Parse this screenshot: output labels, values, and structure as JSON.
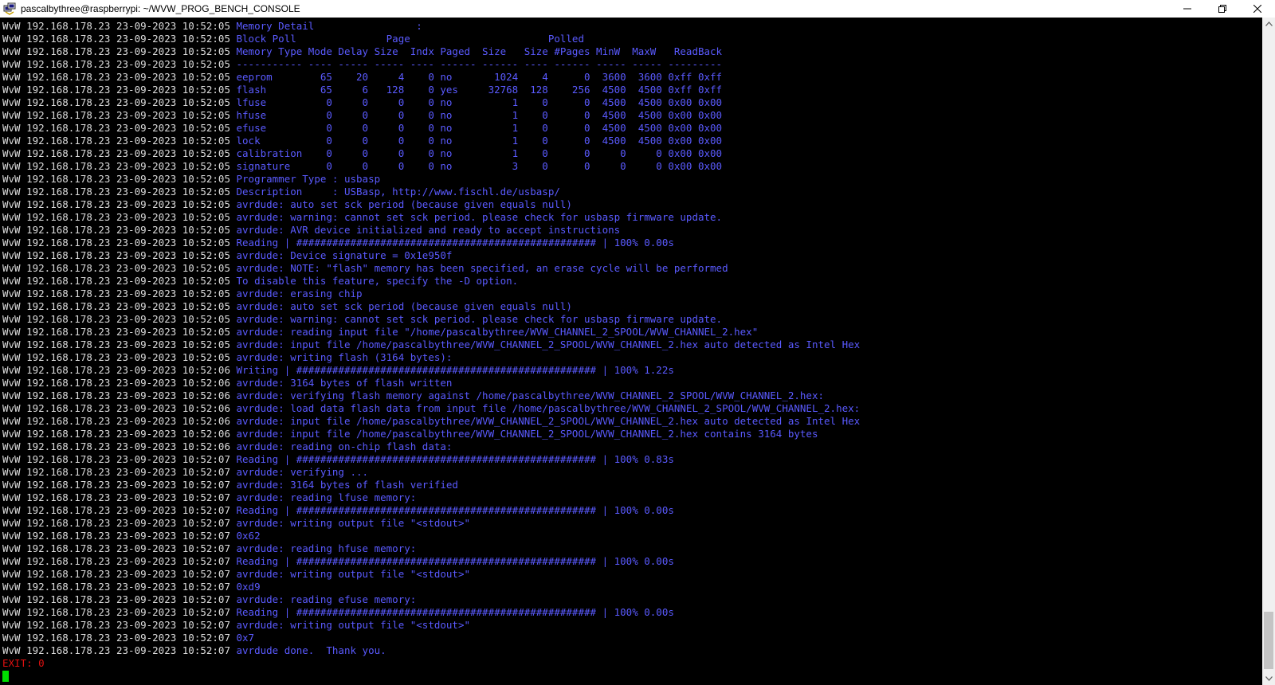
{
  "window": {
    "title": "pascalbythree@raspberrypi: ~/WVW_PROG_BENCH_CONSOLE",
    "controls": [
      "minimize",
      "restore",
      "close"
    ]
  },
  "colors": {
    "background": "#000000",
    "prefix": "#dcdcdc",
    "message": "#5a5aff",
    "exit": "#e01010",
    "cursor": "#00dd00"
  },
  "terminal": {
    "prefix_part": "WvW 192.168.178.23 23-09-2023 ",
    "lines": [
      {
        "time": "10:52:05",
        "msg": "Memory Detail                 :"
      },
      {
        "time": "10:52:05",
        "msg": "Block Poll               Page                       Polled"
      },
      {
        "time": "10:52:05",
        "msg": "Memory Type Mode Delay Size  Indx Paged  Size   Size #Pages MinW  MaxW   ReadBack"
      },
      {
        "time": "10:52:05",
        "msg": "----------- ---- ----- ----- ---- ------ ------ ---- ------ ----- ----- ---------"
      },
      {
        "time": "10:52:05",
        "msg": "eeprom        65    20     4    0 no       1024    4      0  3600  3600 0xff 0xff"
      },
      {
        "time": "10:52:05",
        "msg": "flash         65     6   128    0 yes     32768  128    256  4500  4500 0xff 0xff"
      },
      {
        "time": "10:52:05",
        "msg": "lfuse          0     0     0    0 no          1    0      0  4500  4500 0x00 0x00"
      },
      {
        "time": "10:52:05",
        "msg": "hfuse          0     0     0    0 no          1    0      0  4500  4500 0x00 0x00"
      },
      {
        "time": "10:52:05",
        "msg": "efuse          0     0     0    0 no          1    0      0  4500  4500 0x00 0x00"
      },
      {
        "time": "10:52:05",
        "msg": "lock           0     0     0    0 no          1    0      0  4500  4500 0x00 0x00"
      },
      {
        "time": "10:52:05",
        "msg": "calibration    0     0     0    0 no          1    0      0     0     0 0x00 0x00"
      },
      {
        "time": "10:52:05",
        "msg": "signature      0     0     0    0 no          3    0      0     0     0 0x00 0x00"
      },
      {
        "time": "10:52:05",
        "msg": "Programmer Type : usbasp"
      },
      {
        "time": "10:52:05",
        "msg": "Description     : USBasp, http://www.fischl.de/usbasp/"
      },
      {
        "time": "10:52:05",
        "msg": "avrdude: auto set sck period (because given equals null)"
      },
      {
        "time": "10:52:05",
        "msg": "avrdude: warning: cannot set sck period. please check for usbasp firmware update."
      },
      {
        "time": "10:52:05",
        "msg": "avrdude: AVR device initialized and ready to accept instructions"
      },
      {
        "time": "10:52:05",
        "msg": "Reading | ################################################## | 100% 0.00s"
      },
      {
        "time": "10:52:05",
        "msg": "avrdude: Device signature = 0x1e950f"
      },
      {
        "time": "10:52:05",
        "msg": "avrdude: NOTE: \"flash\" memory has been specified, an erase cycle will be performed"
      },
      {
        "time": "10:52:05",
        "msg": "To disable this feature, specify the -D option."
      },
      {
        "time": "10:52:05",
        "msg": "avrdude: erasing chip"
      },
      {
        "time": "10:52:05",
        "msg": "avrdude: auto set sck period (because given equals null)"
      },
      {
        "time": "10:52:05",
        "msg": "avrdude: warning: cannot set sck period. please check for usbasp firmware update."
      },
      {
        "time": "10:52:05",
        "msg": "avrdude: reading input file \"/home/pascalbythree/WVW_CHANNEL_2_SPOOL/WVW_CHANNEL_2.hex\""
      },
      {
        "time": "10:52:05",
        "msg": "avrdude: input file /home/pascalbythree/WVW_CHANNEL_2_SPOOL/WVW_CHANNEL_2.hex auto detected as Intel Hex"
      },
      {
        "time": "10:52:05",
        "msg": "avrdude: writing flash (3164 bytes):"
      },
      {
        "time": "10:52:06",
        "msg": "Writing | ################################################## | 100% 1.22s"
      },
      {
        "time": "10:52:06",
        "msg": "avrdude: 3164 bytes of flash written"
      },
      {
        "time": "10:52:06",
        "msg": "avrdude: verifying flash memory against /home/pascalbythree/WVW_CHANNEL_2_SPOOL/WVW_CHANNEL_2.hex:"
      },
      {
        "time": "10:52:06",
        "msg": "avrdude: load data flash data from input file /home/pascalbythree/WVW_CHANNEL_2_SPOOL/WVW_CHANNEL_2.hex:"
      },
      {
        "time": "10:52:06",
        "msg": "avrdude: input file /home/pascalbythree/WVW_CHANNEL_2_SPOOL/WVW_CHANNEL_2.hex auto detected as Intel Hex"
      },
      {
        "time": "10:52:06",
        "msg": "avrdude: input file /home/pascalbythree/WVW_CHANNEL_2_SPOOL/WVW_CHANNEL_2.hex contains 3164 bytes"
      },
      {
        "time": "10:52:06",
        "msg": "avrdude: reading on-chip flash data:"
      },
      {
        "time": "10:52:07",
        "msg": "Reading | ################################################## | 100% 0.83s"
      },
      {
        "time": "10:52:07",
        "msg": "avrdude: verifying ..."
      },
      {
        "time": "10:52:07",
        "msg": "avrdude: 3164 bytes of flash verified"
      },
      {
        "time": "10:52:07",
        "msg": "avrdude: reading lfuse memory:"
      },
      {
        "time": "10:52:07",
        "msg": "Reading | ################################################## | 100% 0.00s"
      },
      {
        "time": "10:52:07",
        "msg": "avrdude: writing output file \"<stdout>\""
      },
      {
        "time": "10:52:07",
        "msg": "0x62"
      },
      {
        "time": "10:52:07",
        "msg": "avrdude: reading hfuse memory:"
      },
      {
        "time": "10:52:07",
        "msg": "Reading | ################################################## | 100% 0.00s"
      },
      {
        "time": "10:52:07",
        "msg": "avrdude: writing output file \"<stdout>\""
      },
      {
        "time": "10:52:07",
        "msg": "0xd9"
      },
      {
        "time": "10:52:07",
        "msg": "avrdude: reading efuse memory:"
      },
      {
        "time": "10:52:07",
        "msg": "Reading | ################################################## | 100% 0.00s"
      },
      {
        "time": "10:52:07",
        "msg": "avrdude: writing output file \"<stdout>\""
      },
      {
        "time": "10:52:07",
        "msg": "0x7"
      },
      {
        "time": "10:52:07",
        "msg": "avrdude done.  Thank you."
      }
    ],
    "exit_line": "EXIT: 0"
  }
}
